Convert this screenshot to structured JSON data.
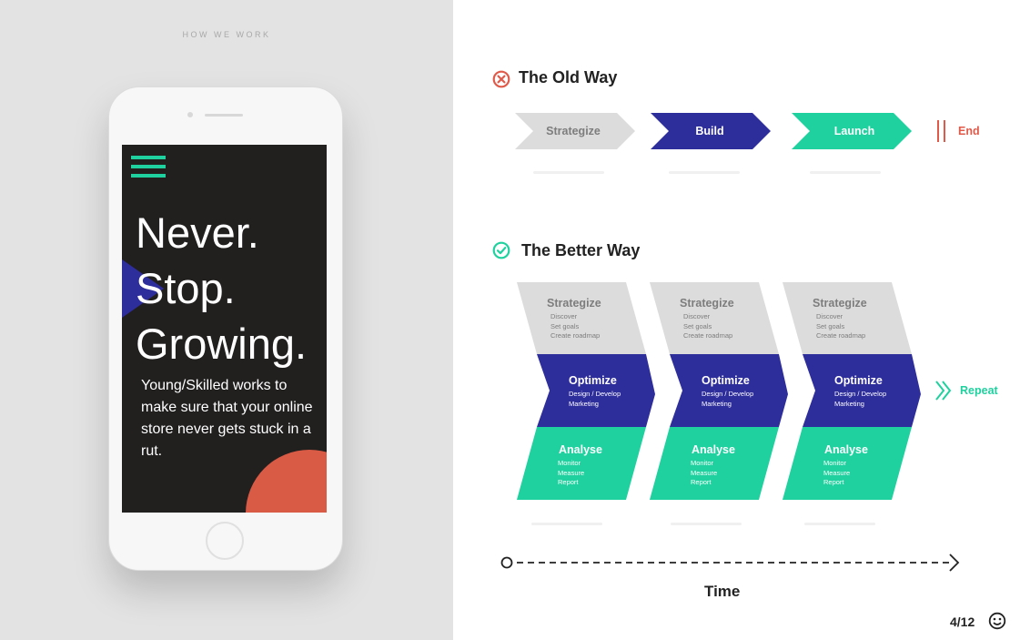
{
  "eyebrow": "HOW WE WORK",
  "phone": {
    "headline": [
      "Never.",
      "Stop.",
      "Growing."
    ],
    "body": "Young/Skilled works to make sure that your online store never gets stuck in a rut."
  },
  "old_way": {
    "title": "The Old Way",
    "steps": [
      "Strategize",
      "Build",
      "Launch"
    ],
    "end_label": "End"
  },
  "better_way": {
    "title": "The Better Way",
    "cycles": [
      {
        "strategize": {
          "title": "Strategize",
          "items": [
            "Discover",
            "Set goals",
            "Create roadmap"
          ]
        },
        "optimize": {
          "title": "Optimize",
          "items": [
            "Design / Develop",
            "Marketing"
          ]
        },
        "analyse": {
          "title": "Analyse",
          "items": [
            "Monitor",
            "Measure",
            "Report"
          ]
        }
      },
      {
        "strategize": {
          "title": "Strategize",
          "items": [
            "Discover",
            "Set goals",
            "Create roadmap"
          ]
        },
        "optimize": {
          "title": "Optimize",
          "items": [
            "Design / Develop",
            "Marketing"
          ]
        },
        "analyse": {
          "title": "Analyse",
          "items": [
            "Monitor",
            "Measure",
            "Report"
          ]
        }
      },
      {
        "strategize": {
          "title": "Strategize",
          "items": [
            "Discover",
            "Set goals",
            "Create roadmap"
          ]
        },
        "optimize": {
          "title": "Optimize",
          "items": [
            "Design / Develop",
            "Marketing"
          ]
        },
        "analyse": {
          "title": "Analyse",
          "items": [
            "Monitor",
            "Measure",
            "Report"
          ]
        }
      }
    ],
    "repeat_label": "Repeat"
  },
  "time_label": "Time",
  "page_number": "4/12",
  "colors": {
    "navy": "#2e2d9c",
    "green": "#1fd19e",
    "gray": "#dcdcdc",
    "coral": "#e05a4a",
    "dark": "#221f1f"
  },
  "icons": {
    "old_way": "x-circle-icon",
    "better_way": "check-circle-icon",
    "repeat": "double-chevron-right-icon",
    "end": "double-bar-icon",
    "brand": "smiley-logo-icon"
  }
}
